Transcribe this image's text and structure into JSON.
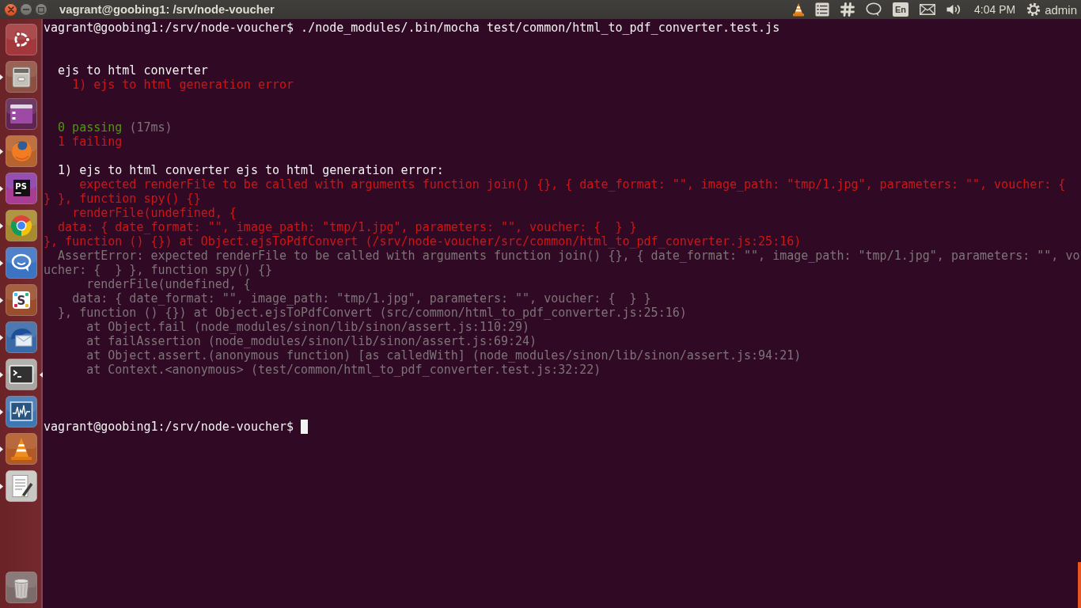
{
  "top_panel": {
    "window_title": "vagrant@goobing1: /srv/node-voucher",
    "keyboard_layout": "En",
    "clock": "4:04 PM",
    "user": "admin"
  },
  "launcher": {
    "items": [
      {
        "kind": "dash",
        "running": false,
        "focused": false
      },
      {
        "kind": "files",
        "running": true,
        "focused": false
      },
      {
        "kind": "workspaces",
        "running": false,
        "focused": false
      },
      {
        "kind": "fox-browser",
        "running": true,
        "focused": false
      },
      {
        "kind": "ide",
        "label": "PS",
        "running": true,
        "focused": false
      },
      {
        "kind": "ring-browser",
        "running": true,
        "focused": false
      },
      {
        "kind": "chat",
        "running": true,
        "focused": false
      },
      {
        "kind": "letter-tile",
        "label": "S",
        "running": true,
        "focused": false
      },
      {
        "kind": "mail",
        "running": true,
        "focused": false
      },
      {
        "kind": "terminal",
        "running": true,
        "focused": true
      },
      {
        "kind": "monitor",
        "running": true,
        "focused": false
      },
      {
        "kind": "cone",
        "running": true,
        "focused": false
      },
      {
        "kind": "editor",
        "running": true,
        "focused": false
      },
      {
        "kind": "trash",
        "running": false,
        "focused": false
      }
    ]
  },
  "terminal": {
    "cursor": true,
    "lines": [
      {
        "kind": "text",
        "segments": [
          {
            "kind": "prompt",
            "text": "vagrant@goobing1:/srv/node-voucher$"
          },
          {
            "kind": "command",
            "text": "./node_modules/.bin/mocha test/common/html_to_pdf_converter.test.js"
          }
        ]
      },
      {
        "kind": "blank"
      },
      {
        "kind": "blank"
      },
      {
        "kind": "text",
        "segments": [
          {
            "kind": "plain",
            "text": "  ejs to html converter"
          }
        ]
      },
      {
        "kind": "text",
        "segments": [
          {
            "kind": "error",
            "text": "    1) ejs to html generation error"
          }
        ]
      },
      {
        "kind": "blank"
      },
      {
        "kind": "blank"
      },
      {
        "kind": "text",
        "segments": [
          {
            "kind": "pass",
            "text": "  0 passing"
          },
          {
            "kind": "muted",
            "text": "(17ms)"
          }
        ]
      },
      {
        "kind": "text",
        "segments": [
          {
            "kind": "error",
            "text": "  1 failing"
          }
        ]
      },
      {
        "kind": "blank"
      },
      {
        "kind": "text",
        "segments": [
          {
            "kind": "plain",
            "text": "  1) ejs to html converter ejs to html generation error:"
          }
        ]
      },
      {
        "kind": "text",
        "segments": [
          {
            "kind": "error",
            "text": "     expected renderFile to be called with arguments function join() {}, { date_format: \"\", image_path: \"tmp/1.jpg\", parameters: \"\", voucher: {"
          }
        ]
      },
      {
        "kind": "text",
        "segments": [
          {
            "kind": "error",
            "text": "} }, function spy() {}"
          }
        ]
      },
      {
        "kind": "text",
        "segments": [
          {
            "kind": "error",
            "text": "    renderFile(undefined, {"
          }
        ]
      },
      {
        "kind": "text",
        "segments": [
          {
            "kind": "error",
            "text": "  data: { date_format: \"\", image_path: \"tmp/1.jpg\", parameters: \"\", voucher: {  } }"
          }
        ]
      },
      {
        "kind": "text",
        "segments": [
          {
            "kind": "error",
            "text": "}, function () {}) at Object.ejsToPdfConvert (/srv/node-voucher/src/common/html_to_pdf_converter.js:25:16)"
          }
        ]
      },
      {
        "kind": "text",
        "segments": [
          {
            "kind": "muted",
            "text": "  AssertError: expected renderFile to be called with arguments function join() {}, { date_format: \"\", image_path: \"tmp/1.jpg\", parameters: \"\", vo"
          }
        ]
      },
      {
        "kind": "text",
        "segments": [
          {
            "kind": "muted",
            "text": "ucher: {  } }, function spy() {}"
          }
        ]
      },
      {
        "kind": "text",
        "segments": [
          {
            "kind": "muted",
            "text": "      renderFile(undefined, {"
          }
        ]
      },
      {
        "kind": "text",
        "segments": [
          {
            "kind": "muted",
            "text": "    data: { date_format: \"\", image_path: \"tmp/1.jpg\", parameters: \"\", voucher: {  } }"
          }
        ]
      },
      {
        "kind": "text",
        "segments": [
          {
            "kind": "muted",
            "text": "  }, function () {}) at Object.ejsToPdfConvert (src/common/html_to_pdf_converter.js:25:16)"
          }
        ]
      },
      {
        "kind": "text",
        "segments": [
          {
            "kind": "muted",
            "text": "      at Object.fail (node_modules/sinon/lib/sinon/assert.js:110:29)"
          }
        ]
      },
      {
        "kind": "text",
        "segments": [
          {
            "kind": "muted",
            "text": "      at failAssertion (node_modules/sinon/lib/sinon/assert.js:69:24)"
          }
        ]
      },
      {
        "kind": "text",
        "segments": [
          {
            "kind": "muted",
            "text": "      at Object.assert.(anonymous function) [as calledWith] (node_modules/sinon/lib/sinon/assert.js:94:21)"
          }
        ]
      },
      {
        "kind": "text",
        "segments": [
          {
            "kind": "muted",
            "text": "      at Context.<anonymous> (test/common/html_to_pdf_converter.test.js:32:22)"
          }
        ]
      },
      {
        "kind": "blank"
      },
      {
        "kind": "blank"
      },
      {
        "kind": "blank"
      },
      {
        "kind": "text",
        "segments": [
          {
            "kind": "prompt",
            "text": "vagrant@goobing1:/srv/node-voucher$"
          }
        ]
      }
    ]
  }
}
